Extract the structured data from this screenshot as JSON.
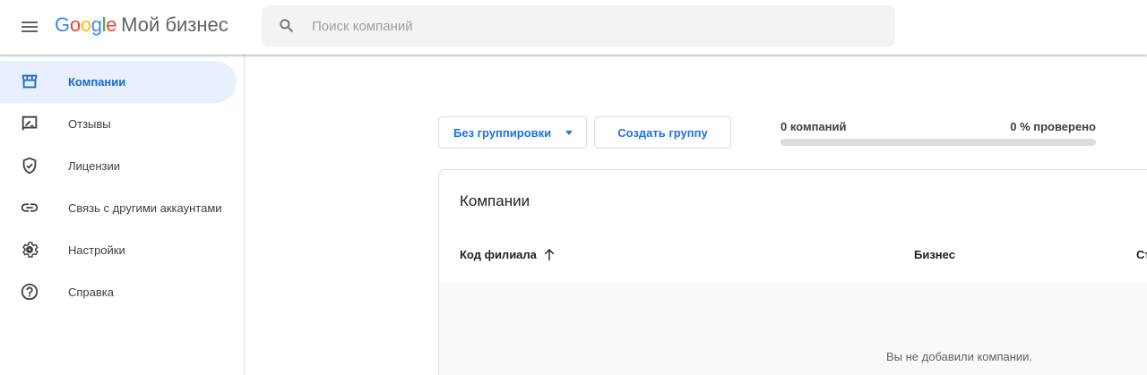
{
  "header": {
    "logo_letters": [
      {
        "char": "G",
        "color": "#4285f4"
      },
      {
        "char": "o",
        "color": "#ea4335"
      },
      {
        "char": "o",
        "color": "#fbbc05"
      },
      {
        "char": "g",
        "color": "#4285f4"
      },
      {
        "char": "l",
        "color": "#34a853"
      },
      {
        "char": "e",
        "color": "#ea4335"
      }
    ],
    "product_name": "Мой бизнес",
    "search_placeholder": "Поиск компаний",
    "menu_icon": "hamburger-menu-icon",
    "search_icon": "search-icon"
  },
  "sidebar": {
    "items": [
      {
        "label": "Компании",
        "icon": "storefront-icon",
        "active": true
      },
      {
        "label": "Отзывы",
        "icon": "review-icon",
        "active": false
      },
      {
        "label": "Лицензии",
        "icon": "shield-check-icon",
        "active": false
      },
      {
        "label": "Связь с другими аккаунтами",
        "icon": "link-icon",
        "active": false
      },
      {
        "label": "Настройки",
        "icon": "gear-icon",
        "active": false
      },
      {
        "label": "Справка",
        "icon": "help-icon",
        "active": false
      }
    ]
  },
  "toolbar": {
    "grouping_selected": "Без группировки",
    "create_group_label": "Создать группу",
    "company_count": "0 компаний",
    "verified_label": "0 % проверено",
    "verified_fraction": 0
  },
  "table": {
    "title": "Компании",
    "columns": [
      "Код филиала",
      "Бизнес",
      "Ст"
    ],
    "sort_icon": "arrow-up-icon",
    "empty_message": "Вы не добавили компании."
  },
  "colors": {
    "accent": "#1a73e8",
    "active_bg": "#e8f0fe",
    "active_text": "#1967d2"
  }
}
